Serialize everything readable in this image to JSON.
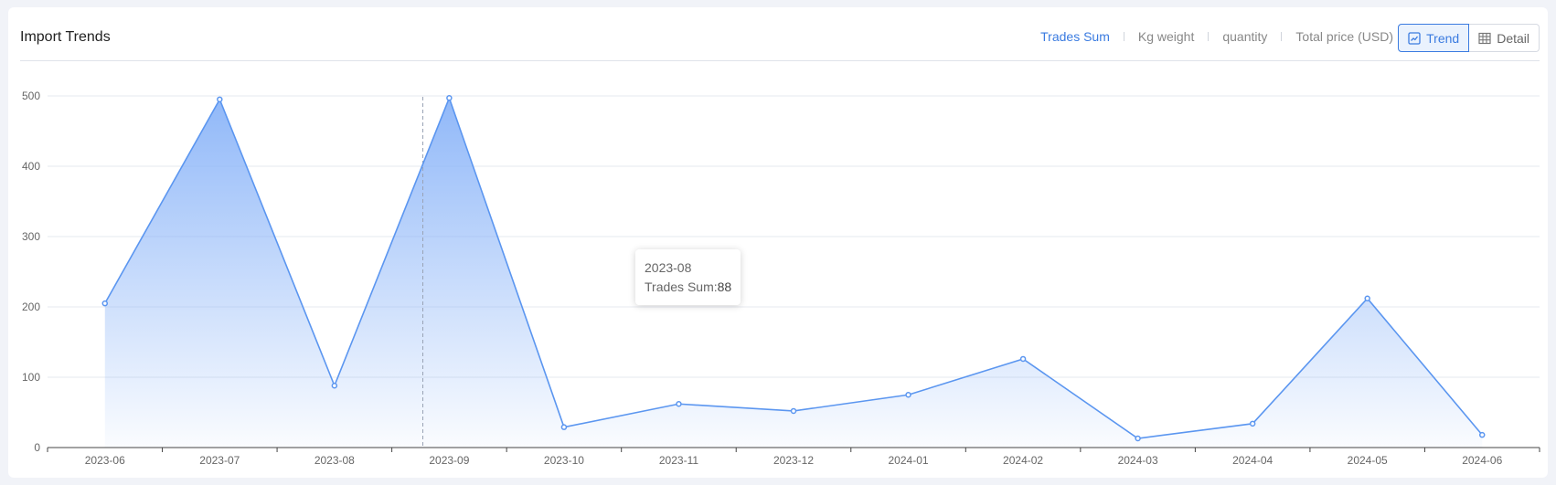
{
  "header": {
    "title": "Import Trends",
    "metrics": [
      "Trades Sum",
      "Kg weight",
      "quantity",
      "Total price (USD)"
    ],
    "active_metric": "Trades Sum",
    "view_trend_label": "Trend",
    "view_detail_label": "Detail"
  },
  "tooltip": {
    "period": "2023-08",
    "label": "Trades Sum:",
    "value": "88"
  },
  "colors": {
    "accent": "#3a7be0",
    "line": "#5b96f0",
    "area_top": "#8ab4f8",
    "grid": "#e6e9ef",
    "axis_text": "#666666"
  },
  "chart_data": {
    "type": "area",
    "title": "",
    "xlabel": "",
    "ylabel": "",
    "categories": [
      "2023-06",
      "2023-07",
      "2023-08",
      "2023-09",
      "2023-10",
      "2023-11",
      "2023-12",
      "2024-01",
      "2024-02",
      "2024-03",
      "2024-04",
      "2024-05",
      "2024-06"
    ],
    "series": [
      {
        "name": "Trades Sum",
        "values": [
          205,
          495,
          88,
          497,
          29,
          62,
          52,
          75,
          126,
          13,
          34,
          212,
          18
        ]
      }
    ],
    "ylim": [
      0,
      500
    ],
    "yticks": [
      0,
      100,
      200,
      300,
      400,
      500
    ],
    "grid": true,
    "legend": "none",
    "hover_category": "2023-08"
  }
}
